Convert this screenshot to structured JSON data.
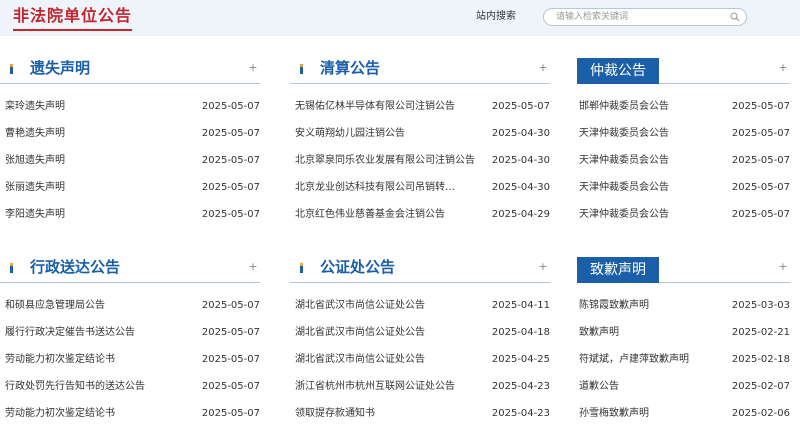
{
  "site": {
    "title": "非法院单位公告"
  },
  "search": {
    "label": "站内搜索",
    "placeholder": "请输入检索关键词"
  },
  "panels": {
    "lost": {
      "title": "遗失声明",
      "items": [
        {
          "title": "栾玲遗失声明",
          "date": "2025-05-07"
        },
        {
          "title": "曹艳遗失声明",
          "date": "2025-05-07"
        },
        {
          "title": "张旭遗失声明",
          "date": "2025-05-07"
        },
        {
          "title": "张丽遗失声明",
          "date": "2025-05-07"
        },
        {
          "title": "李阳遗失声明",
          "date": "2025-05-07"
        }
      ]
    },
    "liquidation": {
      "title": "清算公告",
      "items": [
        {
          "title": "无锡佑亿林半导体有限公司注销公告",
          "date": "2025-05-07"
        },
        {
          "title": "安义萌翔幼儿园注销公告",
          "date": "2025-04-30"
        },
        {
          "title": "北京翠泉同乐农业发展有限公司注销公告",
          "date": "2025-04-30"
        },
        {
          "title": "北京龙业创达科技有限公司吊销转…",
          "date": "2025-04-30"
        },
        {
          "title": "北京红色伟业慈善基金会注销公告",
          "date": "2025-04-29"
        }
      ]
    },
    "arbitration": {
      "title": "仲裁公告",
      "items": [
        {
          "title": "邯郸仲裁委员会公告",
          "date": "2025-05-07"
        },
        {
          "title": "天津仲裁委员会公告",
          "date": "2025-05-07"
        },
        {
          "title": "天津仲裁委员会公告",
          "date": "2025-05-07"
        },
        {
          "title": "天津仲裁委员会公告",
          "date": "2025-05-07"
        },
        {
          "title": "天津仲裁委员会公告",
          "date": "2025-05-07"
        }
      ]
    },
    "admin": {
      "title": "行政送达公告",
      "items": [
        {
          "title": "和硕县应急管理局公告",
          "date": "2025-05-07"
        },
        {
          "title": "履行行政决定催告书送达公告",
          "date": "2025-05-07"
        },
        {
          "title": "劳动能力初次鉴定结论书",
          "date": "2025-05-07"
        },
        {
          "title": "行政处罚先行告知书的送达公告",
          "date": "2025-05-07"
        },
        {
          "title": "劳动能力初次鉴定结论书",
          "date": "2025-05-07"
        }
      ]
    },
    "notary": {
      "title": "公证处公告",
      "items": [
        {
          "title": "湖北省武汉市尚信公证处公告",
          "date": "2025-04-11"
        },
        {
          "title": "湖北省武汉市尚信公证处公告",
          "date": "2025-04-18"
        },
        {
          "title": "湖北省武汉市尚信公证处公告",
          "date": "2025-04-25"
        },
        {
          "title": "浙江省杭州市杭州互联网公证处公告",
          "date": "2025-04-23"
        },
        {
          "title": "领取提存款通知书",
          "date": "2025-04-23"
        }
      ]
    },
    "apology": {
      "title": "致歉声明",
      "items": [
        {
          "title": "陈锦霞致歉声明",
          "date": "2025-03-03"
        },
        {
          "title": "致歉声明",
          "date": "2025-02-21"
        },
        {
          "title": "符斌斌，卢建萍致歉声明",
          "date": "2025-02-18"
        },
        {
          "title": "道歉公告",
          "date": "2025-02-07"
        },
        {
          "title": "孙雪梅致歉声明",
          "date": "2025-02-06"
        }
      ]
    }
  },
  "icons": {
    "search": "search-icon",
    "more": "plus-icon",
    "section": "bar-icon"
  },
  "colors": {
    "brand_red": "#c1272d",
    "accent_blue": "#1a5fa8",
    "topbar_bg": "#eef4fa"
  }
}
